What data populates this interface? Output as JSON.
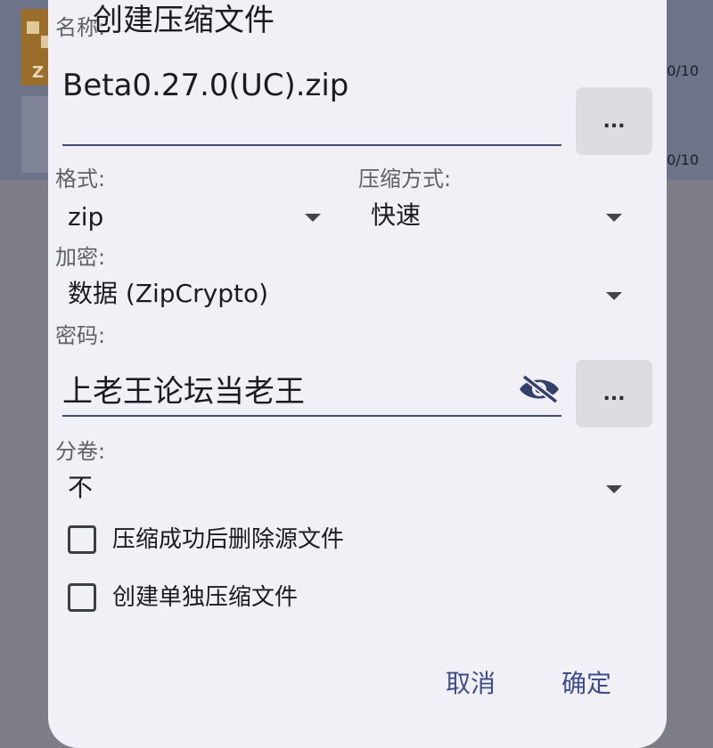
{
  "background": {
    "thumb_letter": "Z",
    "item1_meta": "0/10",
    "item2_meta": "0/10"
  },
  "dialog": {
    "title": "创建压缩文件",
    "name_label": "名称:",
    "name_value": "Beta0.27.0(UC).zip",
    "browse_button": "...",
    "format_label": "格式:",
    "format_value": "zip",
    "method_label": "压缩方式:",
    "method_value": "快速",
    "encrypt_label": "加密:",
    "encrypt_value": "数据 (ZipCrypto)",
    "password_label": "密码:",
    "password_value": "上老王论坛当老王",
    "password_button": "...",
    "split_label": "分卷:",
    "split_value": "不",
    "delete_source_label": "压缩成功后删除源文件",
    "delete_source_checked": false,
    "separate_archive_label": "创建单独压缩文件",
    "separate_archive_checked": false,
    "cancel": "取消",
    "ok": "确定"
  },
  "colors": {
    "accent": "#3f4c8c",
    "dialog_bg": "#f1f0f6",
    "scrim": "#7d7e85"
  },
  "icons": {
    "password_visibility": "eye-off-icon",
    "dropdown": "dropdown-arrow-icon"
  }
}
